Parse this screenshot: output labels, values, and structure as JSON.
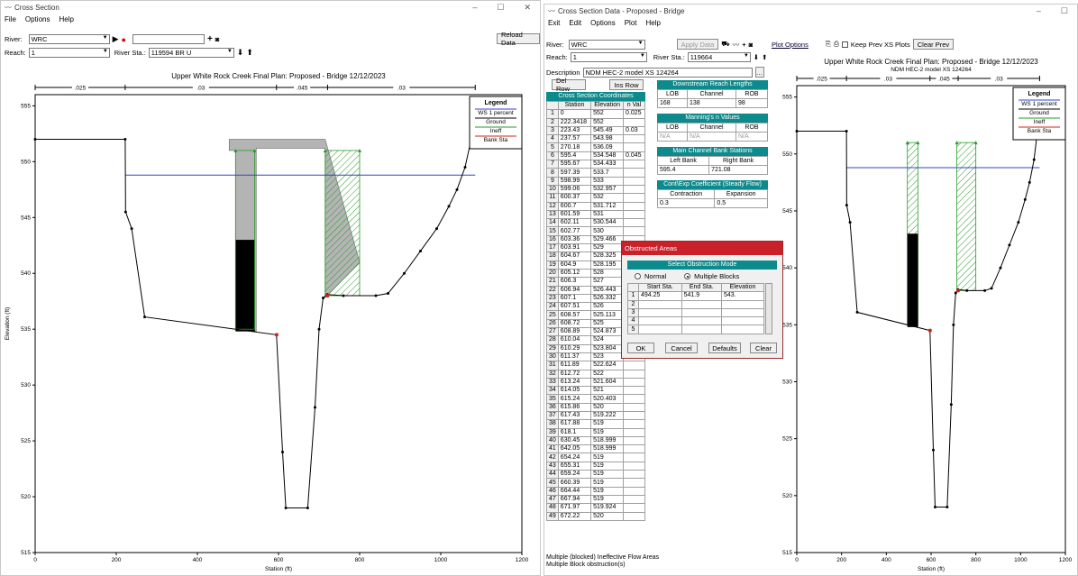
{
  "left_window": {
    "title": "Cross Section",
    "menu": [
      "File",
      "Options",
      "Help"
    ],
    "river_label": "River:",
    "river_value": "WRC",
    "reach_label": "Reach:",
    "reach_value": "1",
    "river_sta_label": "River Sta.:",
    "river_sta_value": "119594  BR U",
    "reload_label": "Reload Data",
    "plot_title": "Upper White Rock Creek Final     Plan: Proposed - Bridge    12/12/2023",
    "ylabel": "Elevation (ft)",
    "xlabel": "Station (ft)",
    "legend": {
      "title": "Legend",
      "items": [
        "WS 1 percent",
        "Ground",
        "Ineff",
        "Bank Sta"
      ]
    },
    "n_values": [
      ".025",
      ".03",
      ".045",
      ".03"
    ]
  },
  "right_window": {
    "title": "Cross Section Data - Proposed - Bridge",
    "menu": [
      "Exit",
      "Edit",
      "Options",
      "Plot",
      "Help"
    ],
    "river_label": "River:",
    "river_value": "WRC",
    "reach_label": "Reach:",
    "reach_value": "1",
    "apply_label": "Apply Data",
    "river_sta_label": "River Sta.:",
    "river_sta_value": "119664",
    "description_label": "Description",
    "description_value": "NDM HEC-2 model XS 124264",
    "del_row": "Del Row",
    "ins_row": "Ins Row",
    "coords_title": "Cross Section Coordinates",
    "col_station": "Station",
    "col_elevation": "Elevation",
    "col_nval": "n Val",
    "rows": [
      [
        "1",
        "0",
        "552",
        "0.025"
      ],
      [
        "2",
        "222.3418",
        "552",
        ""
      ],
      [
        "3",
        "223.43",
        "545.49",
        "0.03"
      ],
      [
        "4",
        "237.57",
        "543.98",
        ""
      ],
      [
        "5",
        "270.18",
        "536.09",
        ""
      ],
      [
        "6",
        "595.4",
        "534.548",
        "0.045"
      ],
      [
        "7",
        "595.67",
        "534.433",
        ""
      ],
      [
        "8",
        "597.39",
        "533.7",
        ""
      ],
      [
        "9",
        "598.99",
        "533",
        ""
      ],
      [
        "10",
        "599.06",
        "532.957",
        ""
      ],
      [
        "11",
        "600.37",
        "532",
        ""
      ],
      [
        "12",
        "600.7",
        "531.712",
        ""
      ],
      [
        "13",
        "601.59",
        "531",
        ""
      ],
      [
        "14",
        "602.11",
        "530.544",
        ""
      ],
      [
        "15",
        "602.77",
        "530",
        ""
      ],
      [
        "16",
        "603.36",
        "529.466",
        ""
      ],
      [
        "17",
        "603.91",
        "529",
        ""
      ],
      [
        "18",
        "604.67",
        "528.325",
        ""
      ],
      [
        "19",
        "604.9",
        "528.195",
        ""
      ],
      [
        "20",
        "605.12",
        "528",
        ""
      ],
      [
        "21",
        "606.3",
        "527",
        ""
      ],
      [
        "22",
        "606.94",
        "526.443",
        ""
      ],
      [
        "23",
        "607.1",
        "526.332",
        ""
      ],
      [
        "24",
        "607.51",
        "526",
        ""
      ],
      [
        "25",
        "608.57",
        "525.113",
        ""
      ],
      [
        "26",
        "608.72",
        "525",
        ""
      ],
      [
        "27",
        "608.89",
        "524.873",
        ""
      ],
      [
        "28",
        "610.04",
        "524",
        ""
      ],
      [
        "29",
        "610.29",
        "523.804",
        ""
      ],
      [
        "30",
        "611.37",
        "523",
        ""
      ],
      [
        "31",
        "611.89",
        "522.624",
        ""
      ],
      [
        "32",
        "612.72",
        "522",
        ""
      ],
      [
        "33",
        "613.24",
        "521.604",
        ""
      ],
      [
        "34",
        "614.05",
        "521",
        ""
      ],
      [
        "35",
        "615.24",
        "520.403",
        ""
      ],
      [
        "36",
        "615.86",
        "520",
        ""
      ],
      [
        "37",
        "617.43",
        "519.222",
        ""
      ],
      [
        "38",
        "617.88",
        "519",
        ""
      ],
      [
        "39",
        "618.1",
        "519",
        ""
      ],
      [
        "40",
        "630.45",
        "518.999",
        ""
      ],
      [
        "41",
        "642.05",
        "518.999",
        ""
      ],
      [
        "42",
        "654.24",
        "519",
        ""
      ],
      [
        "43",
        "655.31",
        "519",
        ""
      ],
      [
        "44",
        "659.24",
        "519",
        ""
      ],
      [
        "45",
        "660.39",
        "519",
        ""
      ],
      [
        "46",
        "664.44",
        "519",
        ""
      ],
      [
        "47",
        "667.94",
        "519",
        ""
      ],
      [
        "48",
        "671.97",
        "519.924",
        ""
      ],
      [
        "49",
        "672.22",
        "520",
        ""
      ]
    ],
    "reach_lengths": {
      "title": "Downstream Reach Lengths",
      "cols": [
        "LOB",
        "Channel",
        "ROB"
      ],
      "vals": [
        "168",
        "138",
        "98"
      ]
    },
    "mannings": {
      "title": "Manning's n Values",
      "cols": [
        "LOB",
        "Channel",
        "ROB"
      ],
      "vals": [
        "N/A",
        "N/A",
        "N/A"
      ]
    },
    "bank_stations": {
      "title": "Main Channel Bank Stations",
      "cols": [
        "Left Bank",
        "Right Bank"
      ],
      "vals": [
        "595.4",
        "721.08"
      ]
    },
    "coefficients": {
      "title": "Cont\\Exp Coefficient (Steady Flow)",
      "cols": [
        "Contraction",
        "Expansion"
      ],
      "vals": [
        "0.3",
        "0.5"
      ]
    },
    "status": [
      "Multiple (blocked) Ineffective Flow Areas",
      "Multiple Block obstruction(s)"
    ],
    "plot_options": "Plot Options",
    "keep_prev": "Keep Prev XS Plots",
    "clear_prev": "Clear Prev",
    "plot_title": "Upper White Rock Creek Final     Plan: Proposed - Bridge    12/12/2023",
    "plot_subtitle": "NDM HEC-2 model XS 124264",
    "xlabel": "Station (ft)",
    "legend": {
      "title": "Legend",
      "items": [
        "WS 1 percent",
        "Ground",
        "Ineff",
        "Bank Sta"
      ]
    },
    "n_values": [
      ".025",
      ".03",
      ".045",
      ".03"
    ]
  },
  "dialog": {
    "title": "Obstructed Areas",
    "mode_title": "Select Obstruction Mode",
    "normal": "Normal",
    "multiple": "Multiple Blocks",
    "cols": [
      "Start Sta.",
      "End Sta.",
      "Elevation"
    ],
    "row": [
      "494.25",
      "541.9",
      "543."
    ],
    "row_numbers": [
      "1",
      "2",
      "3",
      "4",
      "5"
    ],
    "ok": "OK",
    "cancel": "Cancel",
    "defaults": "Defaults",
    "clear": "Clear"
  },
  "chart_data": [
    {
      "type": "line",
      "title": "Upper White Rock Creek Final     Plan: Proposed - Bridge    12/12/2023",
      "xlabel": "Station (ft)",
      "ylabel": "Elevation (ft)",
      "xlim": [
        0,
        1200
      ],
      "ylim": [
        515,
        556
      ],
      "xticks": [
        0,
        200,
        400,
        600,
        800,
        1000,
        1200
      ],
      "yticks": [
        515,
        520,
        525,
        530,
        535,
        540,
        545,
        550,
        555
      ],
      "ground": [
        [
          0,
          552
        ],
        [
          222,
          552
        ],
        [
          223,
          545.5
        ],
        [
          238,
          544
        ],
        [
          270,
          536.1
        ],
        [
          595,
          534.5
        ],
        [
          610,
          524
        ],
        [
          618,
          519
        ],
        [
          672,
          519
        ],
        [
          690,
          528
        ],
        [
          700,
          535
        ],
        [
          710,
          537.8
        ],
        [
          720,
          538.1
        ],
        [
          760,
          538
        ],
        [
          840,
          538
        ],
        [
          870,
          538.2
        ],
        [
          910,
          540
        ],
        [
          950,
          542
        ],
        [
          990,
          544
        ],
        [
          1020,
          546
        ],
        [
          1040,
          547.5
        ],
        [
          1060,
          549.5
        ],
        [
          1075,
          552
        ],
        [
          1085,
          554
        ]
      ],
      "ws_elevation": 548.8,
      "ws_x": [
        222,
        1085
      ],
      "bank_stations": [
        595.4,
        721.08
      ],
      "deck": {
        "low_chord": 551.2,
        "high_chord": 552,
        "x": [
          545,
          715
        ]
      },
      "obstruction": {
        "start": 494.25,
        "end": 541.9,
        "elevation": 543
      }
    },
    {
      "type": "line",
      "title": "Upper White Rock Creek Final     Plan: Proposed - Bridge    12/12/2023",
      "xlabel": "Station (ft)",
      "xlim": [
        0,
        1200
      ],
      "ylim": [
        515,
        556
      ],
      "xticks": [
        0,
        200,
        400,
        600,
        800,
        1000,
        1200
      ],
      "yticks": [
        515,
        520,
        525,
        530,
        535,
        540,
        545,
        550,
        555
      ],
      "ws_elevation": 548.8,
      "ineffective": [
        [
          494,
          541,
          551
        ],
        [
          715,
          800,
          551
        ]
      ]
    }
  ]
}
